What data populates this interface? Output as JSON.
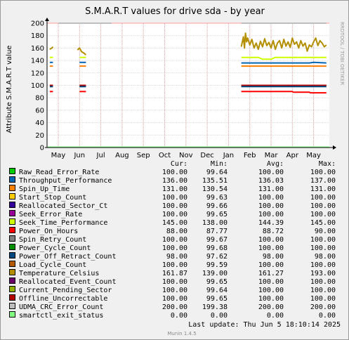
{
  "chart_data": {
    "type": "line",
    "title": "S.M.A.R.T values for drive sda - by year",
    "ylabel": "Attribute S.M.A.R.T value",
    "xlabel": "",
    "ylim": [
      0,
      200
    ],
    "yticks": [
      "0",
      "20",
      "40",
      "60",
      "80",
      "100",
      "120",
      "140",
      "160",
      "180",
      "200"
    ],
    "xticks": [
      "May",
      "Jun",
      "Jul",
      "Aug",
      "Sep",
      "Oct",
      "Nov",
      "Dec",
      "Jan",
      "Feb",
      "Mar",
      "Apr",
      "May"
    ],
    "grid": true,
    "legend_placement": "bottom",
    "columns": [
      "Cur:",
      "Min:",
      "Avg:",
      "Max:"
    ],
    "series": [
      {
        "name": "Raw_Read_Error_Rate",
        "color": "#00cc00",
        "values": [
          "100.00",
          "99.64",
          "100.00",
          "100.00"
        ]
      },
      {
        "name": "Throughput_Performance",
        "color": "#0066b3",
        "values": [
          "136.00",
          "135.51",
          "136.03",
          "137.00"
        ]
      },
      {
        "name": "Spin_Up_Time",
        "color": "#ff8000",
        "values": [
          "131.00",
          "130.54",
          "131.00",
          "131.00"
        ]
      },
      {
        "name": "Start_Stop_Count",
        "color": "#ffcc00",
        "values": [
          "100.00",
          "99.63",
          "100.00",
          "100.00"
        ]
      },
      {
        "name": "Reallocated_Sector_Ct",
        "color": "#330099",
        "values": [
          "100.00",
          "99.66",
          "100.00",
          "100.00"
        ]
      },
      {
        "name": "Seek_Error_Rate",
        "color": "#990099",
        "values": [
          "100.00",
          "99.65",
          "100.00",
          "100.00"
        ]
      },
      {
        "name": "Seek_Time_Performance",
        "color": "#ccff00",
        "values": [
          "145.00",
          "138.00",
          "144.39",
          "145.00"
        ]
      },
      {
        "name": "Power_On_Hours",
        "color": "#ff0000",
        "values": [
          "88.00",
          "87.77",
          "88.72",
          "90.00"
        ]
      },
      {
        "name": "Spin_Retry_Count",
        "color": "#808080",
        "values": [
          "100.00",
          "99.67",
          "100.00",
          "100.00"
        ]
      },
      {
        "name": "Power_Cycle_Count",
        "color": "#008f00",
        "values": [
          "100.00",
          "99.68",
          "100.00",
          "100.00"
        ]
      },
      {
        "name": "Power_Off_Retract_Count",
        "color": "#00487d",
        "values": [
          "98.00",
          "97.62",
          "98.00",
          "98.00"
        ]
      },
      {
        "name": "Load_Cycle_Count",
        "color": "#b35a00",
        "values": [
          "100.00",
          "99.59",
          "100.00",
          "100.00"
        ]
      },
      {
        "name": "Temperature_Celsius",
        "color": "#b38f00",
        "values": [
          "161.87",
          "139.00",
          "161.27",
          "193.00"
        ]
      },
      {
        "name": "Reallocated_Event_Count",
        "color": "#6b006b",
        "values": [
          "100.00",
          "99.65",
          "100.00",
          "100.00"
        ]
      },
      {
        "name": "Current_Pending_Sector",
        "color": "#8fb300",
        "values": [
          "100.00",
          "99.64",
          "100.00",
          "100.00"
        ]
      },
      {
        "name": "Offline_Uncorrectable",
        "color": "#b30000",
        "values": [
          "100.00",
          "99.65",
          "100.00",
          "100.00"
        ]
      },
      {
        "name": "UDMA_CRC_Error_Count",
        "color": "#bebebe",
        "values": [
          "200.00",
          "199.38",
          "200.00",
          "200.00"
        ]
      },
      {
        "name": "smartctl_exit_status",
        "color": "#80ff80",
        "values": [
          "0.00",
          "0.00",
          "0.00",
          "0.00"
        ]
      }
    ],
    "lines": [
      {
        "series": "UDMA_CRC_Error_Count",
        "segments": [
          [
            [
              0.0,
              200
            ],
            [
              2.5,
              200
            ]
          ],
          [
            [
              8.6,
              200
            ],
            [
              12.6,
              200
            ]
          ]
        ]
      },
      {
        "series": "Seek_Time_Performance",
        "segments": [
          [
            [
              -0.4,
              145
            ],
            [
              -0.25,
              145
            ]
          ],
          [
            [
              1.0,
              145
            ],
            [
              1.3,
              145
            ]
          ],
          [
            [
              8.6,
              145
            ],
            [
              9.4,
              145
            ],
            [
              9.6,
              142
            ],
            [
              10.0,
              142
            ],
            [
              10.2,
              145
            ],
            [
              12.6,
              145
            ]
          ]
        ]
      },
      {
        "series": "Throughput_Performance",
        "segments": [
          [
            [
              -0.4,
              137
            ],
            [
              -0.25,
              137
            ]
          ],
          [
            [
              1.0,
              137
            ],
            [
              1.3,
              137
            ]
          ],
          [
            [
              8.6,
              136
            ],
            [
              11.8,
              136
            ],
            [
              12.0,
              137
            ],
            [
              12.6,
              136
            ]
          ]
        ]
      },
      {
        "series": "Spin_Up_Time",
        "segments": [
          [
            [
              -0.4,
              131
            ],
            [
              -0.25,
              131
            ]
          ],
          [
            [
              1.0,
              131
            ],
            [
              1.3,
              131
            ]
          ],
          [
            [
              8.6,
              131
            ],
            [
              12.6,
              131
            ]
          ]
        ]
      },
      {
        "series": "Start_Stop_Count",
        "segments": [
          [
            [
              -0.4,
              100
            ],
            [
              -0.25,
              100
            ]
          ],
          [
            [
              1.0,
              100
            ],
            [
              1.3,
              100
            ]
          ],
          [
            [
              8.6,
              100
            ],
            [
              12.6,
              100
            ]
          ]
        ]
      },
      {
        "series": "Offline_Uncorrectable",
        "segments": [
          [
            [
              -0.4,
              100
            ],
            [
              -0.25,
              100
            ]
          ],
          [
            [
              1.0,
              100
            ],
            [
              1.3,
              100
            ]
          ],
          [
            [
              8.6,
              100
            ],
            [
              12.6,
              100
            ]
          ]
        ]
      },
      {
        "series": "Power_Off_Retract_Count",
        "segments": [
          [
            [
              -0.4,
              98
            ],
            [
              -0.25,
              98
            ]
          ],
          [
            [
              1.0,
              98
            ],
            [
              1.3,
              98
            ]
          ],
          [
            [
              8.6,
              98
            ],
            [
              12.6,
              98
            ]
          ]
        ]
      },
      {
        "series": "Power_On_Hours",
        "segments": [
          [
            [
              -0.4,
              90
            ],
            [
              -0.25,
              90
            ]
          ],
          [
            [
              1.0,
              90
            ],
            [
              1.3,
              90
            ]
          ],
          [
            [
              8.6,
              90
            ],
            [
              11.0,
              90
            ],
            [
              11.05,
              89
            ],
            [
              11.8,
              89
            ],
            [
              11.85,
              88
            ],
            [
              12.6,
              88
            ]
          ]
        ]
      },
      {
        "series": "Temperature_Celsius",
        "segments": [
          [
            [
              -0.4,
              158
            ],
            [
              -0.3,
              160
            ],
            [
              -0.25,
              162
            ]
          ],
          [
            [
              0.9,
              157
            ],
            [
              1.0,
              160
            ],
            [
              1.1,
              154
            ],
            [
              1.2,
              152
            ],
            [
              1.3,
              149
            ]
          ],
          [
            [
              8.6,
              162
            ],
            [
              8.7,
              178
            ],
            [
              8.75,
              160
            ],
            [
              8.8,
              184
            ],
            [
              8.85,
              170
            ],
            [
              8.9,
              176
            ],
            [
              9.0,
              165
            ],
            [
              9.1,
              174
            ],
            [
              9.2,
              160
            ],
            [
              9.3,
              168
            ],
            [
              9.4,
              158
            ],
            [
              9.5,
              171
            ],
            [
              9.6,
              162
            ],
            [
              9.7,
              175
            ],
            [
              9.8,
              164
            ],
            [
              9.9,
              169
            ],
            [
              10.0,
              160
            ],
            [
              10.1,
              172
            ],
            [
              10.2,
              158
            ],
            [
              10.3,
              168
            ],
            [
              10.4,
              172
            ],
            [
              10.5,
              160
            ],
            [
              10.6,
              174
            ],
            [
              10.7,
              163
            ],
            [
              10.8,
              170
            ],
            [
              10.9,
              161
            ],
            [
              11.0,
              176
            ],
            [
              11.1,
              166
            ],
            [
              11.2,
              170
            ],
            [
              11.3,
              160
            ],
            [
              11.4,
              172
            ],
            [
              11.5,
              163
            ],
            [
              11.6,
              168
            ],
            [
              11.7,
              155
            ],
            [
              11.8,
              165
            ],
            [
              11.9,
              162
            ],
            [
              12.0,
              170
            ],
            [
              12.1,
              176
            ],
            [
              12.2,
              164
            ],
            [
              12.3,
              172
            ],
            [
              12.4,
              168
            ],
            [
              12.5,
              162
            ],
            [
              12.6,
              165
            ]
          ]
        ]
      }
    ]
  },
  "footer": {
    "last_update": "Last update:  Thu Jun  5 18:10:14 2025",
    "generator": "Munin 1.4.5"
  },
  "watermark": "RRDTOOL / TOBI OETIKER"
}
